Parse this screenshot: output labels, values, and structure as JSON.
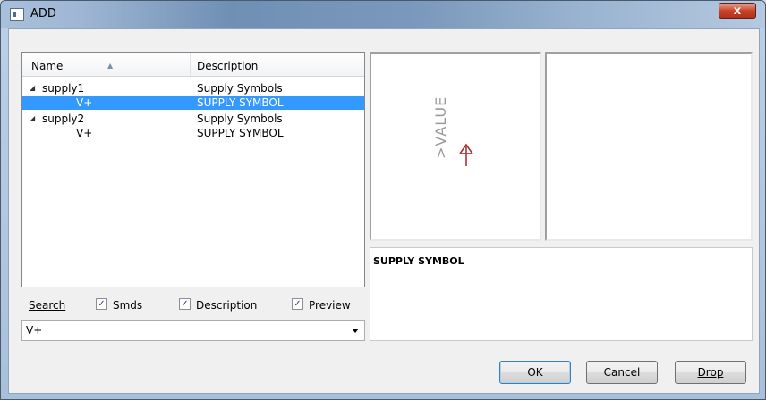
{
  "window": {
    "title": "ADD",
    "close_label": "x"
  },
  "list": {
    "columns": {
      "name": "Name",
      "description": "Description"
    },
    "rows": [
      {
        "expander": "◢",
        "name": "supply1",
        "description": "Supply Symbols"
      },
      {
        "name": "V+",
        "description": "SUPPLY SYMBOL"
      },
      {
        "expander": "◢",
        "name": "supply2",
        "description": "Supply Symbols"
      },
      {
        "name": "V+",
        "description": "SUPPLY SYMBOL"
      }
    ]
  },
  "search": {
    "label_prefix": "",
    "label": "Search",
    "value": "V+",
    "checkboxes": [
      {
        "label": "Smds",
        "checked": true,
        "mark": "✓"
      },
      {
        "label": "Description",
        "checked": true,
        "mark": "✓"
      },
      {
        "label": "Preview",
        "checked": true,
        "mark": "✓"
      }
    ]
  },
  "preview": {
    "symbol_text": ">VALUE",
    "symbol_color": "#b03030"
  },
  "description": {
    "text": "SUPPLY SYMBOL"
  },
  "buttons": {
    "ok": "OK",
    "cancel": "Cancel",
    "drop": "Drop"
  }
}
